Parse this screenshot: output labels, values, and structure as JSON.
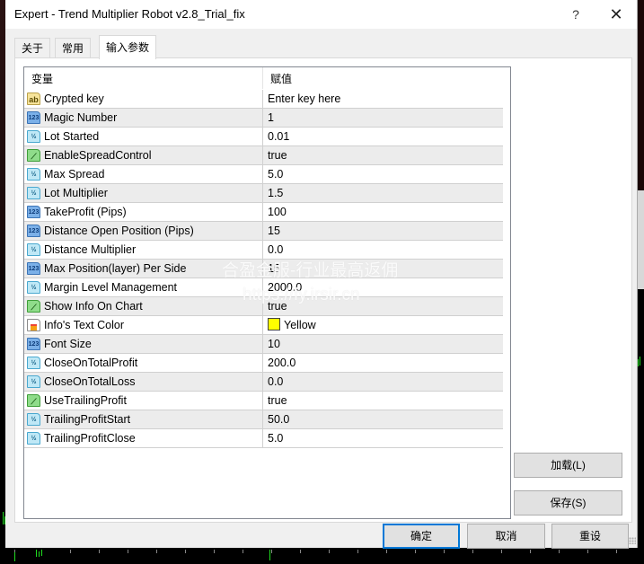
{
  "window": {
    "title": "Expert - Trend Multiplier Robot v2.8_Trial_fix",
    "help_label": "?",
    "close_label": "✕"
  },
  "tabs": [
    {
      "label": "关于",
      "active": false
    },
    {
      "label": "常用",
      "active": false
    },
    {
      "label": "输入参数",
      "active": true
    }
  ],
  "grid": {
    "columns": [
      "变量",
      "赋值"
    ],
    "rows": [
      {
        "icon": "string-type-icon",
        "type": "str",
        "glyph": "ab",
        "name": "Crypted key",
        "value": "Enter key here"
      },
      {
        "icon": "integer-type-icon",
        "type": "int",
        "glyph": "123",
        "name": "Magic Number",
        "value": "1"
      },
      {
        "icon": "double-type-icon",
        "type": "dbl",
        "glyph": "½",
        "name": "Lot Started",
        "value": "0.01"
      },
      {
        "icon": "bool-type-icon",
        "type": "bool",
        "glyph": "⟋",
        "name": "EnableSpreadControl",
        "value": "true"
      },
      {
        "icon": "double-type-icon",
        "type": "dbl",
        "glyph": "½",
        "name": "Max Spread",
        "value": "5.0"
      },
      {
        "icon": "double-type-icon",
        "type": "dbl",
        "glyph": "½",
        "name": "Lot Multiplier",
        "value": "1.5"
      },
      {
        "icon": "integer-type-icon",
        "type": "int",
        "glyph": "123",
        "name": "TakeProfit (Pips)",
        "value": "100"
      },
      {
        "icon": "integer-type-icon",
        "type": "int",
        "glyph": "123",
        "name": "Distance Open Position (Pips)",
        "value": "15"
      },
      {
        "icon": "double-type-icon",
        "type": "dbl",
        "glyph": "½",
        "name": "Distance Multiplier",
        "value": "0.0"
      },
      {
        "icon": "integer-type-icon",
        "type": "int",
        "glyph": "123",
        "name": "Max Position(layer) Per Side",
        "value": "15"
      },
      {
        "icon": "double-type-icon",
        "type": "dbl",
        "glyph": "½",
        "name": "Margin Level Management",
        "value": "2000.0"
      },
      {
        "icon": "bool-type-icon",
        "type": "bool",
        "glyph": "⟋",
        "name": "Show Info On Chart",
        "value": "true"
      },
      {
        "icon": "color-type-icon",
        "type": "clr",
        "glyph": "",
        "name": "Info's Text Color",
        "value": "Yellow",
        "swatch": "#ffff00"
      },
      {
        "icon": "integer-type-icon",
        "type": "int",
        "glyph": "123",
        "name": "Font Size",
        "value": "10"
      },
      {
        "icon": "double-type-icon",
        "type": "dbl",
        "glyph": "½",
        "name": "CloseOnTotalProfit",
        "value": "200.0"
      },
      {
        "icon": "double-type-icon",
        "type": "dbl",
        "glyph": "½",
        "name": "CloseOnTotalLoss",
        "value": "0.0"
      },
      {
        "icon": "bool-type-icon",
        "type": "bool",
        "glyph": "⟋",
        "name": "UseTrailingProfit",
        "value": "true"
      },
      {
        "icon": "double-type-icon",
        "type": "dbl",
        "glyph": "½",
        "name": "TrailingProfitStart",
        "value": "50.0"
      },
      {
        "icon": "double-type-icon",
        "type": "dbl",
        "glyph": "½",
        "name": "TrailingProfitClose",
        "value": "5.0"
      }
    ]
  },
  "buttons": {
    "load": "加载(L)",
    "save": "保存(S)",
    "ok": "确定",
    "cancel": "取消",
    "reset": "重设"
  },
  "watermark": {
    "line1": "合盈金服-行业最高返佣",
    "line2": "https://fy.irsir.cn"
  }
}
